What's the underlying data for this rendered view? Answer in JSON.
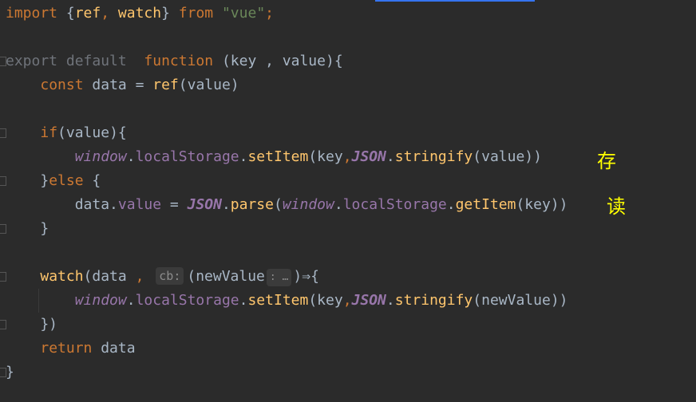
{
  "editor": {
    "lines": [
      [
        {
          "t": "import ",
          "c": "kw"
        },
        {
          "t": "{",
          "c": "txt"
        },
        {
          "t": "ref",
          "c": "fn"
        },
        {
          "t": ", ",
          "c": "kw"
        },
        {
          "t": "watch",
          "c": "fn"
        },
        {
          "t": "} ",
          "c": "txt"
        },
        {
          "t": "from ",
          "c": "kw"
        },
        {
          "t": "\"vue\"",
          "c": "str"
        },
        {
          "t": ";",
          "c": "kw"
        }
      ],
      [],
      [
        {
          "t": "export default  ",
          "c": "dim"
        },
        {
          "t": "function ",
          "c": "kw"
        },
        {
          "t": "(key , value){",
          "c": "txt"
        }
      ],
      [
        {
          "t": "    ",
          "c": "txt"
        },
        {
          "t": "const ",
          "c": "kw"
        },
        {
          "t": "data = ",
          "c": "txt"
        },
        {
          "t": "ref",
          "c": "fn"
        },
        {
          "t": "(value)",
          "c": "txt"
        }
      ],
      [],
      [
        {
          "t": "    ",
          "c": "txt"
        },
        {
          "t": "if",
          "c": "kw"
        },
        {
          "t": "(value){",
          "c": "txt"
        }
      ],
      [
        {
          "t": "        ",
          "c": "txt"
        },
        {
          "t": "window",
          "c": "gl"
        },
        {
          "t": ".",
          "c": "txt"
        },
        {
          "t": "localStorage",
          "c": "prop"
        },
        {
          "t": ".",
          "c": "txt"
        },
        {
          "t": "setItem",
          "c": "fn"
        },
        {
          "t": "(key",
          "c": "txt"
        },
        {
          "t": ",",
          "c": "kw"
        },
        {
          "t": "JSON",
          "c": "glb"
        },
        {
          "t": ".",
          "c": "txt"
        },
        {
          "t": "stringify",
          "c": "fn"
        },
        {
          "t": "(value))",
          "c": "txt"
        }
      ],
      [
        {
          "t": "    ",
          "c": "txt"
        },
        {
          "t": "}",
          "c": "txt"
        },
        {
          "t": "else ",
          "c": "kw"
        },
        {
          "t": "{",
          "c": "txt"
        }
      ],
      [
        {
          "t": "        ",
          "c": "txt"
        },
        {
          "t": "data.",
          "c": "txt"
        },
        {
          "t": "value",
          "c": "prop"
        },
        {
          "t": " = ",
          "c": "txt"
        },
        {
          "t": "JSON",
          "c": "glb"
        },
        {
          "t": ".",
          "c": "txt"
        },
        {
          "t": "parse",
          "c": "fn"
        },
        {
          "t": "(",
          "c": "txt"
        },
        {
          "t": "window",
          "c": "gl"
        },
        {
          "t": ".",
          "c": "txt"
        },
        {
          "t": "localStorage",
          "c": "prop"
        },
        {
          "t": ".",
          "c": "txt"
        },
        {
          "t": "getItem",
          "c": "fn"
        },
        {
          "t": "(key))",
          "c": "txt"
        }
      ],
      [
        {
          "t": "    }",
          "c": "txt"
        }
      ],
      [],
      [
        {
          "t": "    ",
          "c": "txt"
        },
        {
          "t": "watch",
          "c": "fn"
        },
        {
          "t": "(data ",
          "c": "txt"
        },
        {
          "t": ", ",
          "c": "kw"
        },
        {
          "t": "cb:",
          "c": "hint"
        },
        {
          "t": "(newValue",
          "c": "txt"
        },
        {
          "t": ": …",
          "c": "hint small"
        },
        {
          "t": ")⇒{",
          "c": "txt"
        }
      ],
      [
        {
          "t": "        ",
          "c": "txt"
        },
        {
          "t": "window",
          "c": "gl"
        },
        {
          "t": ".",
          "c": "txt"
        },
        {
          "t": "localStorage",
          "c": "prop"
        },
        {
          "t": ".",
          "c": "txt"
        },
        {
          "t": "setItem",
          "c": "fn"
        },
        {
          "t": "(key",
          "c": "txt"
        },
        {
          "t": ",",
          "c": "kw"
        },
        {
          "t": "JSON",
          "c": "glb"
        },
        {
          "t": ".",
          "c": "txt"
        },
        {
          "t": "stringify",
          "c": "fn"
        },
        {
          "t": "(newValue))",
          "c": "txt"
        }
      ],
      [
        {
          "t": "    })",
          "c": "txt"
        }
      ],
      [
        {
          "t": "    ",
          "c": "txt"
        },
        {
          "t": "return ",
          "c": "kw"
        },
        {
          "t": "data",
          "c": "txt"
        }
      ],
      [
        {
          "t": "}",
          "c": "txt"
        }
      ]
    ]
  },
  "annotations": {
    "store": "存",
    "read": "读"
  },
  "colors": {
    "background": "#2b2b2b",
    "keyword": "#cc7832",
    "function": "#ffc66d",
    "string": "#6a8759",
    "global": "#9876aa",
    "annotation": "#ffff00"
  }
}
